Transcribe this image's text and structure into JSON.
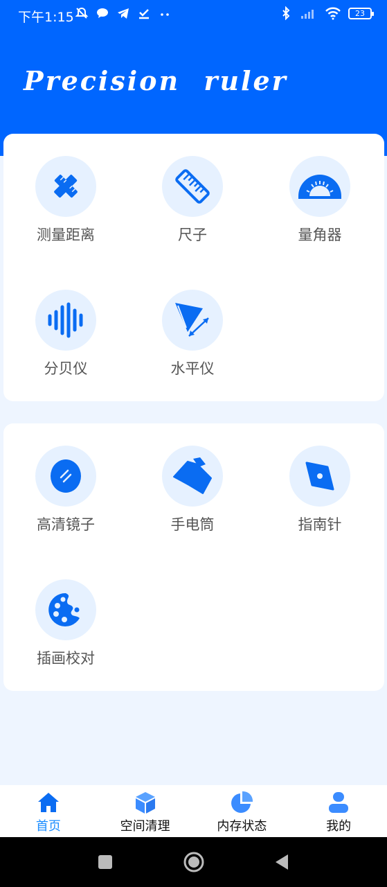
{
  "status_bar": {
    "time": "下午1:15",
    "battery": "23"
  },
  "header": {
    "title": "Precision ruler"
  },
  "tools_primary": [
    {
      "label": "测量距离",
      "icon": "ruler-cross-icon"
    },
    {
      "label": "尺子",
      "icon": "ruler-icon"
    },
    {
      "label": "量角器",
      "icon": "protractor-icon"
    },
    {
      "label": "分贝仪",
      "icon": "sound-wave-icon"
    },
    {
      "label": "水平仪",
      "icon": "level-icon"
    }
  ],
  "tools_secondary": [
    {
      "label": "高清镜子",
      "icon": "mirror-icon"
    },
    {
      "label": "手电筒",
      "icon": "flashlight-icon"
    },
    {
      "label": "指南针",
      "icon": "compass-icon"
    },
    {
      "label": "插画校对",
      "icon": "palette-icon"
    }
  ],
  "bottom_nav": [
    {
      "label": "首页",
      "icon": "home-icon",
      "active": true
    },
    {
      "label": "空间清理",
      "icon": "cube-icon",
      "active": false
    },
    {
      "label": "内存状态",
      "icon": "pie-chart-icon",
      "active": false
    },
    {
      "label": "我的",
      "icon": "user-icon",
      "active": false
    }
  ],
  "colors": {
    "primary": "#0066ff",
    "icon_bg": "#e6f1ff",
    "page_bg": "#eef5ff",
    "nav_active": "#1a8cff",
    "nav_icon": "#3b8cff"
  }
}
